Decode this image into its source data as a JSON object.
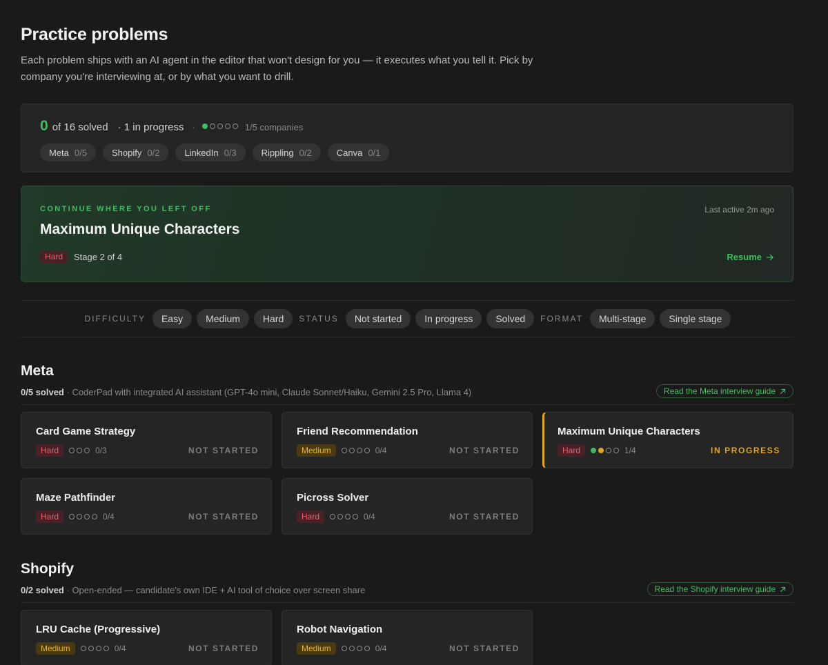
{
  "header": {
    "title": "Practice problems",
    "intro": "Each problem ships with an AI agent in the editor that won't design for you — it executes what you tell it. Pick by company you're interviewing at, or by what you want to drill."
  },
  "summary": {
    "solved_count": "0",
    "solved_suffix": "of 16 solved",
    "in_progress": "· 1 in progress",
    "sep": "·",
    "companies_progress": "1/5 companies",
    "company_dots": {
      "filled": 1,
      "total": 5
    },
    "companies": [
      {
        "name": "Meta",
        "count": "0/5"
      },
      {
        "name": "Shopify",
        "count": "0/2"
      },
      {
        "name": "LinkedIn",
        "count": "0/3"
      },
      {
        "name": "Rippling",
        "count": "0/2"
      },
      {
        "name": "Canva",
        "count": "0/1"
      }
    ]
  },
  "continue_card": {
    "eyebrow": "CONTINUE WHERE YOU LEFT OFF",
    "last_active": "Last active 2m ago",
    "title": "Maximum Unique Characters",
    "difficulty": "Hard",
    "stage": "Stage 2 of 4",
    "resume_label": "Resume",
    "resume_icon": "arrow-right-icon"
  },
  "filters": {
    "difficulty_label": "DIFFICULTY",
    "difficulty": [
      "Easy",
      "Medium",
      "Hard"
    ],
    "status_label": "STATUS",
    "status": [
      "Not started",
      "In progress",
      "Solved"
    ],
    "format_label": "FORMAT",
    "format": [
      "Multi-stage",
      "Single stage"
    ]
  },
  "sections": [
    {
      "name": "Meta",
      "solved": "0/5 solved",
      "description": "· CoderPad with integrated AI assistant (GPT-4o mini, Claude Sonnet/Haiku, Gemini 2.5 Pro, Llama 4)",
      "guide_label": "Read the Meta interview guide",
      "guide_icon": "arrow-up-right-icon",
      "problems": [
        {
          "title": "Card Game Strategy",
          "difficulty": "Hard",
          "stages_done": 0,
          "stages_active": 0,
          "stages_total": 3,
          "progress": "0/3",
          "status": "NOT STARTED"
        },
        {
          "title": "Friend Recommendation",
          "difficulty": "Medium",
          "stages_done": 0,
          "stages_active": 0,
          "stages_total": 4,
          "progress": "0/4",
          "status": "NOT STARTED"
        },
        {
          "title": "Maximum Unique Characters",
          "difficulty": "Hard",
          "stages_done": 1,
          "stages_active": 1,
          "stages_total": 4,
          "progress": "1/4",
          "status": "IN PROGRESS"
        },
        {
          "title": "Maze Pathfinder",
          "difficulty": "Hard",
          "stages_done": 0,
          "stages_active": 0,
          "stages_total": 4,
          "progress": "0/4",
          "status": "NOT STARTED"
        },
        {
          "title": "Picross Solver",
          "difficulty": "Hard",
          "stages_done": 0,
          "stages_active": 0,
          "stages_total": 4,
          "progress": "0/4",
          "status": "NOT STARTED"
        }
      ]
    },
    {
      "name": "Shopify",
      "solved": "0/2 solved",
      "description": "· Open-ended — candidate's own IDE + AI tool of choice over screen share",
      "guide_label": "Read the Shopify interview guide",
      "guide_icon": "arrow-up-right-icon",
      "problems": [
        {
          "title": "LRU Cache (Progressive)",
          "difficulty": "Medium",
          "stages_done": 0,
          "stages_active": 0,
          "stages_total": 4,
          "progress": "0/4",
          "status": "NOT STARTED"
        },
        {
          "title": "Robot Navigation",
          "difficulty": "Medium",
          "stages_done": 0,
          "stages_active": 0,
          "stages_total": 4,
          "progress": "0/4",
          "status": "NOT STARTED"
        }
      ]
    }
  ]
}
